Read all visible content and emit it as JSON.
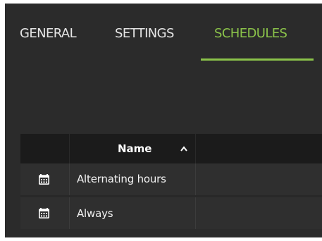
{
  "tabs": [
    {
      "label": "GENERAL",
      "active": false
    },
    {
      "label": "SETTINGS",
      "active": false
    },
    {
      "label": "SCHEDULES",
      "active": true
    }
  ],
  "colors": {
    "accent": "#8bc34a",
    "background": "#2b2b2b",
    "header_background": "#1b1b1b",
    "row_background": "#2f2f2f"
  },
  "table": {
    "columns": [
      {
        "label": "",
        "icon": null
      },
      {
        "label": "Name",
        "sort": "ascending",
        "icon": "chevron-up-icon"
      },
      {
        "label": ""
      }
    ],
    "rows": [
      {
        "icon": "calendar-icon",
        "name": "Alternating hours"
      },
      {
        "icon": "calendar-icon",
        "name": "Always"
      }
    ]
  }
}
